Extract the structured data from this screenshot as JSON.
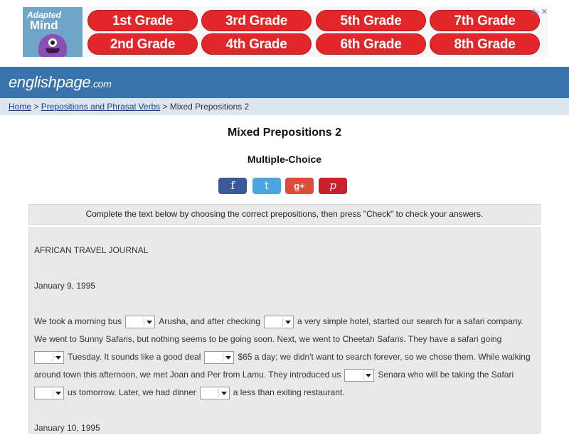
{
  "ad": {
    "logo_line1": "Adapted",
    "logo_line2": "Mind",
    "grades": [
      "1st Grade",
      "3rd Grade",
      "5th Grade",
      "7th Grade",
      "2nd Grade",
      "4th Grade",
      "6th Grade",
      "8th Grade"
    ],
    "close_glyphs": "▷ ✕"
  },
  "header": {
    "logo_main": "englishpage",
    "logo_tld": ".com"
  },
  "breadcrumb": {
    "home": "Home",
    "sep1": " > ",
    "section": "Prepositions and Phrasal Verbs",
    "sep2": " > ",
    "current": "Mixed Prepositions 2"
  },
  "page": {
    "title": "Mixed Prepositions 2",
    "subtitle": "Multiple-Choice"
  },
  "share": {
    "facebook": "f",
    "twitter": "t",
    "googleplus": "g+",
    "pinterest": "p"
  },
  "instructions": "Complete the text below by choosing the correct prepositions, then press \"Check\" to check your answers.",
  "exercise": {
    "heading": "AFRICAN TRAVEL JOURNAL",
    "date1": "January 9, 1995",
    "l1a": "We took a morning bus",
    "l1b": "Arusha, and after checking",
    "l1c": "a very simple hotel, started our search for a safari company.",
    "l2": "We went to Sunny Safaris, but nothing seems to be going soon. Next, we went to Cheetah Safaris. They have a safari going",
    "l3a": "Tuesday. It sounds like a good deal",
    "l3b": "$65 a day; we didn't want to search forever, so we chose them. While walking",
    "l4a": "around town this afternoon, we met Joan and Per from Lamu. They introduced us",
    "l4b": "Senara who will be taking the Safari",
    "l5a": "us tomorrow. Later, we had dinner",
    "l5b": "a less than exiting restaurant.",
    "date2": "January 10, 1995"
  }
}
